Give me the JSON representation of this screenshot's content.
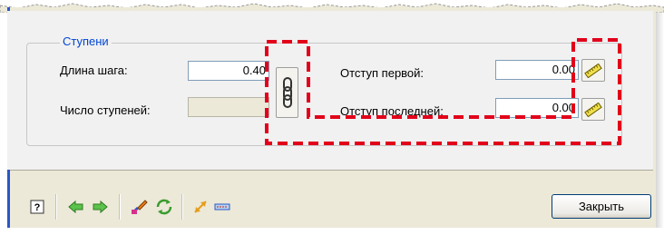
{
  "group": {
    "title": "Ступени"
  },
  "step_length": {
    "label": "Длина шага:",
    "value": "0.40"
  },
  "step_count": {
    "label": "Число ступеней:",
    "value": ""
  },
  "first_offset": {
    "label": "Отступ первой:",
    "value": "0.00"
  },
  "last_offset": {
    "label": "Отступ последней:",
    "value": "0.00"
  },
  "footer": {
    "close_label": "Закрыть"
  },
  "icons": {
    "link": "chain-link-icon",
    "ruler": "ruler-icon",
    "help": "help-icon",
    "back": "arrow-left-icon",
    "forward": "arrow-right-icon",
    "paint": "paint-brush-icon",
    "refresh": "refresh-icon",
    "resize": "resize-arrow-icon",
    "dimension": "dimension-icon"
  },
  "colors": {
    "highlight": "#e2001a",
    "group_title": "#0046d5",
    "accent": "#2a57c9"
  }
}
